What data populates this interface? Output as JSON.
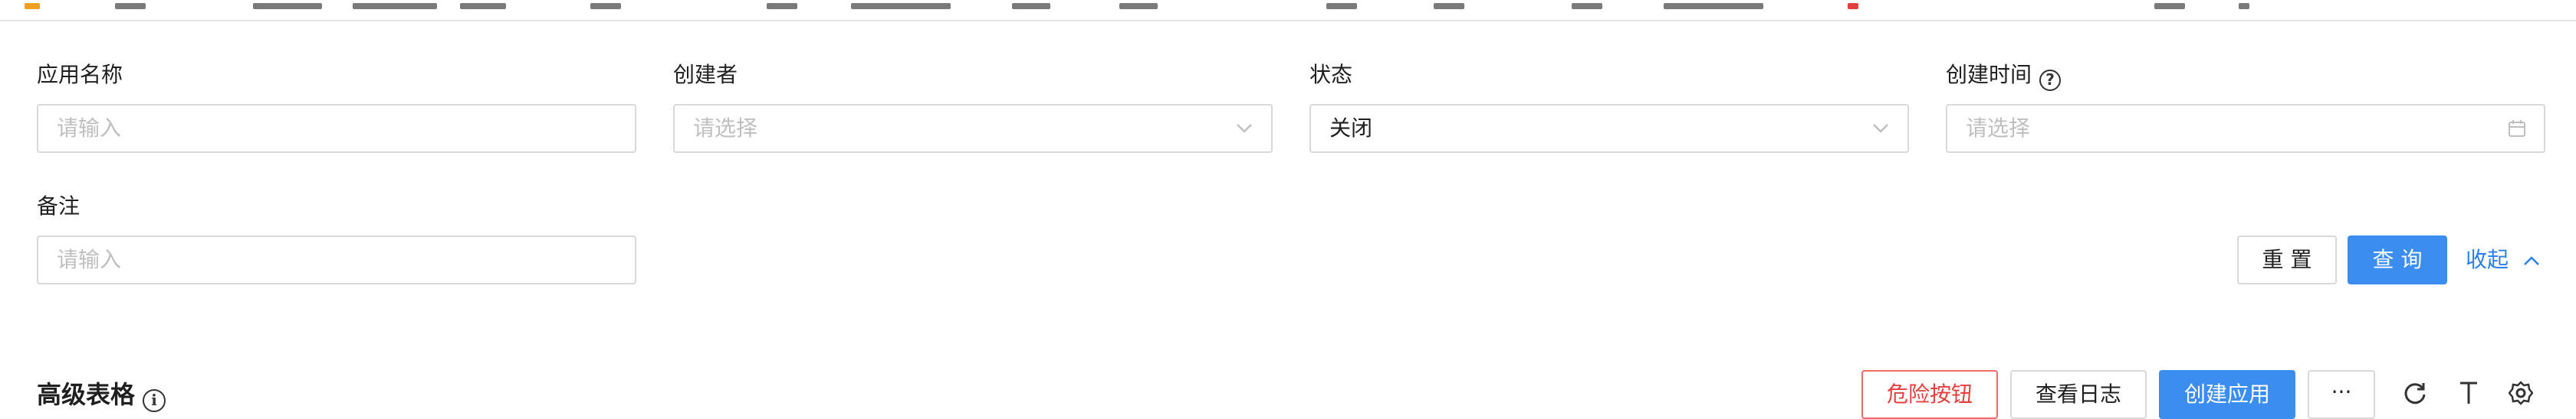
{
  "form": {
    "app_name": {
      "label": "应用名称",
      "placeholder": "请输入"
    },
    "creator": {
      "label": "创建者",
      "placeholder": "请选择"
    },
    "status": {
      "label": "状态",
      "value": "关闭"
    },
    "created_time": {
      "label": "创建时间",
      "help": "?",
      "placeholder": "请选择"
    },
    "remark": {
      "label": "备注",
      "placeholder": "请输入"
    },
    "reset_label": "重 置",
    "query_label": "查 询",
    "collapse_label": "收起"
  },
  "table": {
    "title": "高级表格",
    "info": "i",
    "danger_label": "危险按钮",
    "log_label": "查看日志",
    "create_label": "创建应用",
    "more_label": "···"
  },
  "icons": {
    "refresh": "refresh-icon",
    "density": "column-height-icon",
    "settings": "setting-icon",
    "calendar": "calendar-icon",
    "chevron": "chevron-down-icon",
    "up": "chevron-up-icon"
  },
  "colors": {
    "primary": "#3b8ef0",
    "danger": "#e53e3e",
    "link": "#2b7ff0",
    "border": "#d9d9d9",
    "placeholder": "#bfbfbf"
  }
}
